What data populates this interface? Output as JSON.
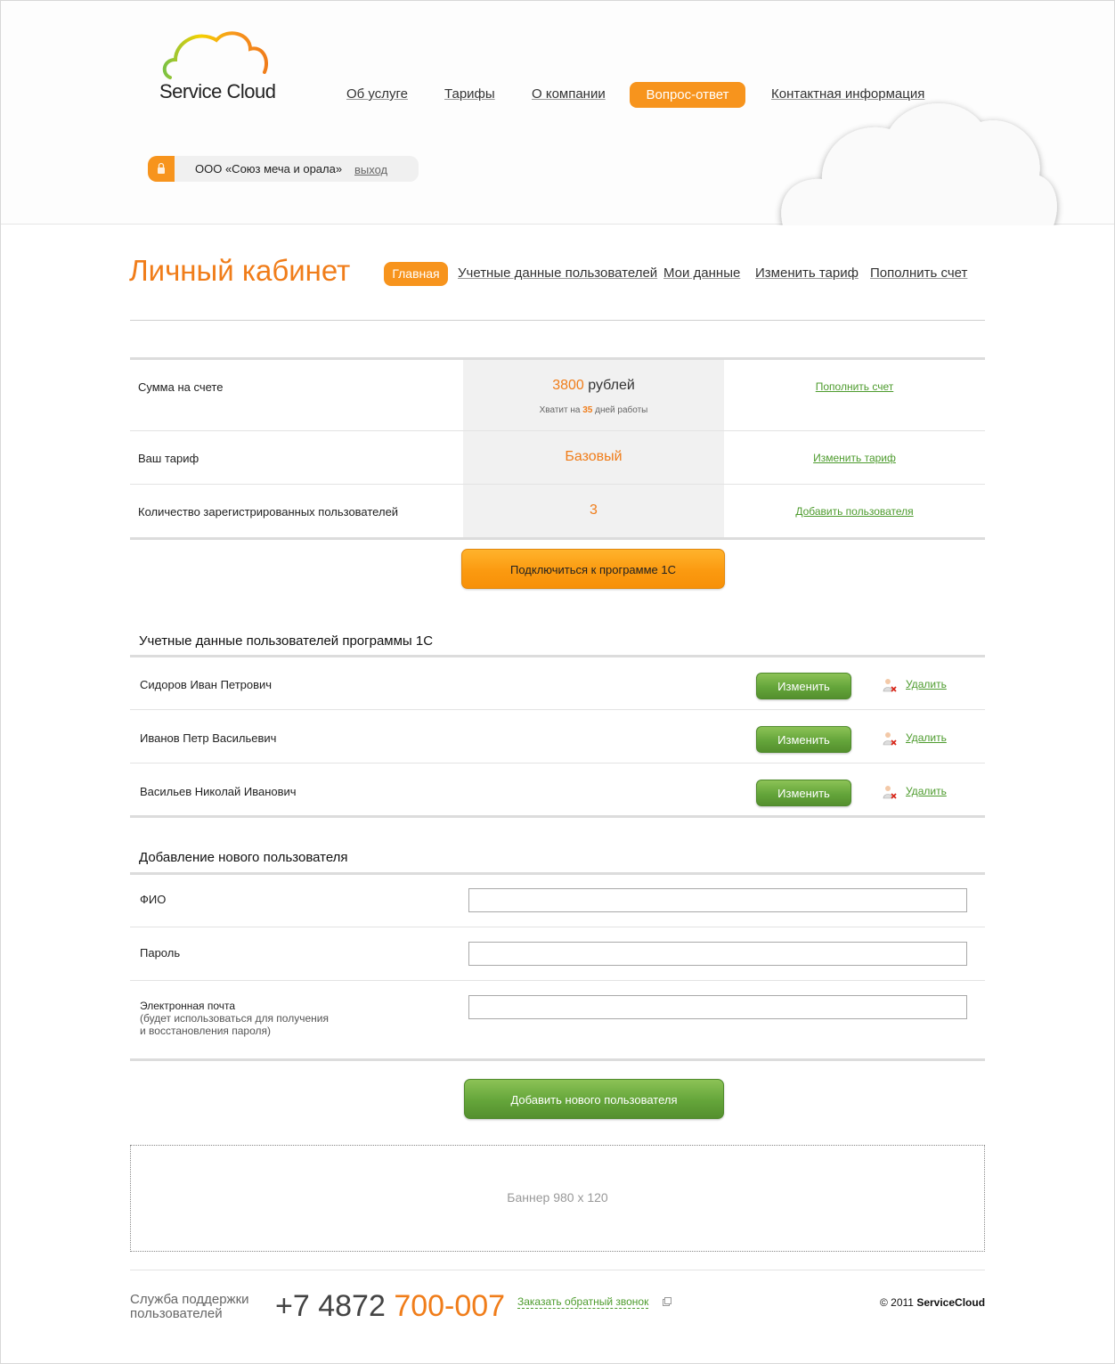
{
  "header": {
    "logo_text": "Service Cloud",
    "nav": [
      {
        "label": "Об услуге"
      },
      {
        "label": "Тарифы"
      },
      {
        "label": "О компании"
      },
      {
        "label": "Вопрос-ответ",
        "active": true
      },
      {
        "label": "Контактная информация"
      }
    ],
    "account": {
      "company": "ООО «Союз меча и орала»",
      "logout": "выход"
    }
  },
  "page": {
    "title": "Личный кабинет",
    "subnav": [
      {
        "label": "Главная",
        "active": true
      },
      {
        "label": "Учетные данные пользователей"
      },
      {
        "label": "Мои данные"
      },
      {
        "label": "Изменить тариф"
      },
      {
        "label": "Пополнить счет"
      }
    ]
  },
  "summary": {
    "balance": {
      "label": "Сумма на счете",
      "amount": "3800",
      "currency": "рублей",
      "hint_prefix": "Хватит на",
      "hint_days": "35",
      "hint_suffix": "дней работы",
      "action": "Пополнить счет"
    },
    "tariff": {
      "label": "Ваш тариф",
      "value": "Базовый",
      "action": "Изменить тариф"
    },
    "users": {
      "label": "Количество зарегистрированных пользователей",
      "value": "3",
      "action": "Добавить пользователя"
    },
    "connect_button": "Подключиться к программе 1С"
  },
  "users_section": {
    "title": "Учетные данные пользователей программы 1С",
    "edit_label": "Изменить",
    "delete_label": "Удалить",
    "users": [
      {
        "name": "Сидоров Иван Петрович"
      },
      {
        "name": "Иванов Петр Васильевич"
      },
      {
        "name": "Васильев Николай Иванович"
      }
    ]
  },
  "add_user": {
    "title": "Добавление нового пользователя",
    "fields": {
      "fio": {
        "label": "ФИО",
        "value": ""
      },
      "password": {
        "label": "Пароль",
        "value": ""
      },
      "email": {
        "label": "Электронная почта",
        "note_line1": "(будет использоваться для получения",
        "note_line2": "и восстановления пароля)",
        "value": ""
      }
    },
    "submit": "Добавить нового пользователя"
  },
  "banner": {
    "text": "Баннер 980 х 120"
  },
  "footer": {
    "support_line1": "Служба поддержки",
    "support_line2": "пользователей",
    "phone_prefix": "+7 4872",
    "phone_number": "700-007",
    "callback": "Заказать обратный звонок",
    "copyright_prefix": "© 2011",
    "copyright_brand": "ServiceCloud"
  },
  "colors": {
    "accent_orange": "#f7941d",
    "title_orange": "#f07d1a",
    "link_green": "#4d9b2d",
    "button_green": "#64a53a"
  },
  "icons": [
    "cloud-logo-icon",
    "lock-icon",
    "user-delete-icon",
    "external-link-icon"
  ]
}
